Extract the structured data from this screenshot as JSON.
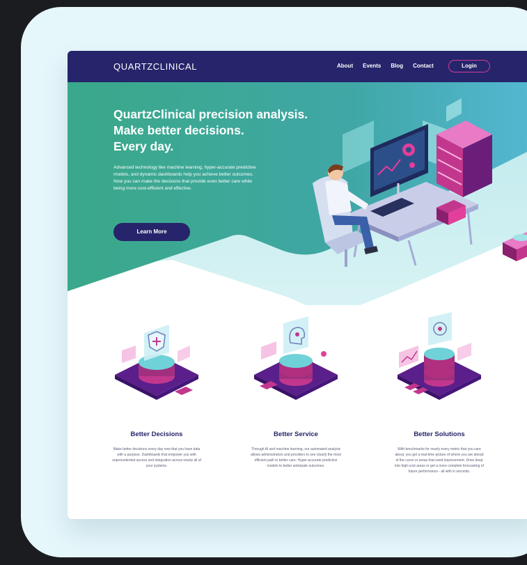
{
  "header": {
    "logo": "QUARTZCLINICAL",
    "nav": [
      "About",
      "Events",
      "Blog",
      "Contact"
    ],
    "login_label": "Login"
  },
  "hero": {
    "title_lines": [
      "QuartzClinical precision analysis.",
      "Make better decisions.",
      "Every day."
    ],
    "body": "Advanced technology like machine learning, hyper-accurate predictive models, and dynamic dashboards help you achieve better outcomes. Now you can make the decisions that provide even better care while being more cost-efficient and effective.",
    "cta_label": "Learn More"
  },
  "features": [
    {
      "title": "Better Decisions",
      "icon": "shield-database-icon",
      "body": "Make better decisions every day now that you have data with a purpose. Dashboards that empower you with unprecedented access and integration across nearly all of your systems."
    },
    {
      "title": "Better Service",
      "icon": "brain-database-icon",
      "body": "Through AI and machine learning, our automated analysis allows administrators and providers to see clearly the most efficient path to better care. Hyper-accurate predictive models to better anticipate outcomes."
    },
    {
      "title": "Better Solutions",
      "icon": "target-database-icon",
      "body": "With benchmarks for nearly every metric that you care about, you get a real-time picture of where you are ahead of the curve or areas that need improvement. Drive deep into high-cost areas or get a more complete forecasting of future performance - all with in seconds."
    }
  ],
  "colors": {
    "navy": "#26246a",
    "teal": "#3aa889",
    "magenta": "#c2378d",
    "frame": "#e6f7fb",
    "background": "#1b1c20"
  }
}
